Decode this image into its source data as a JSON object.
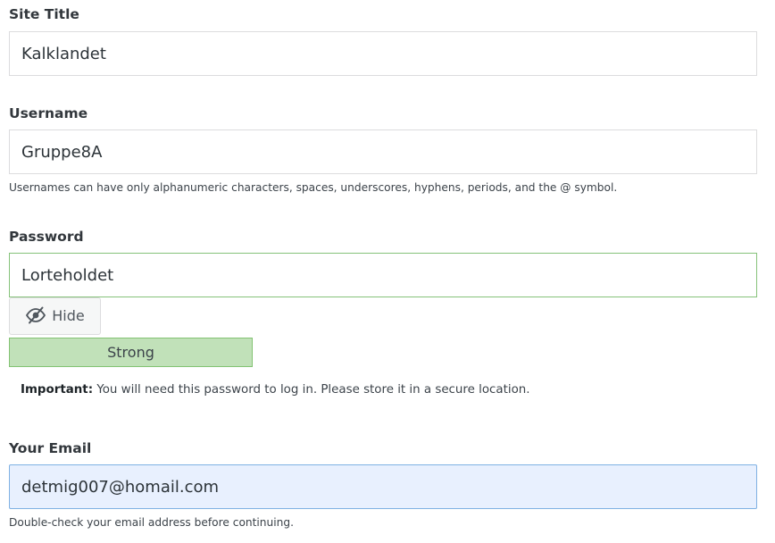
{
  "site_title": {
    "label": "Site Title",
    "value": "Kalklandet"
  },
  "username": {
    "label": "Username",
    "value": "Gruppe8A",
    "hint": "Usernames can have only alphanumeric characters, spaces, underscores, hyphens, periods, and the @ symbol."
  },
  "password": {
    "label": "Password",
    "value": "Lorteholdet",
    "toggle_label": "Hide",
    "toggle_icon": "eye-slash-icon",
    "strength": "Strong",
    "strength_color": "#c1e1b9",
    "important_bold": "Important:",
    "important_text": " You will need this password to log in. Please store it in a secure location."
  },
  "email": {
    "label": "Your Email",
    "value": "detmig007@homail.com",
    "autofill_color": "#e8f0fe",
    "hint": "Double-check your email address before continuing."
  }
}
